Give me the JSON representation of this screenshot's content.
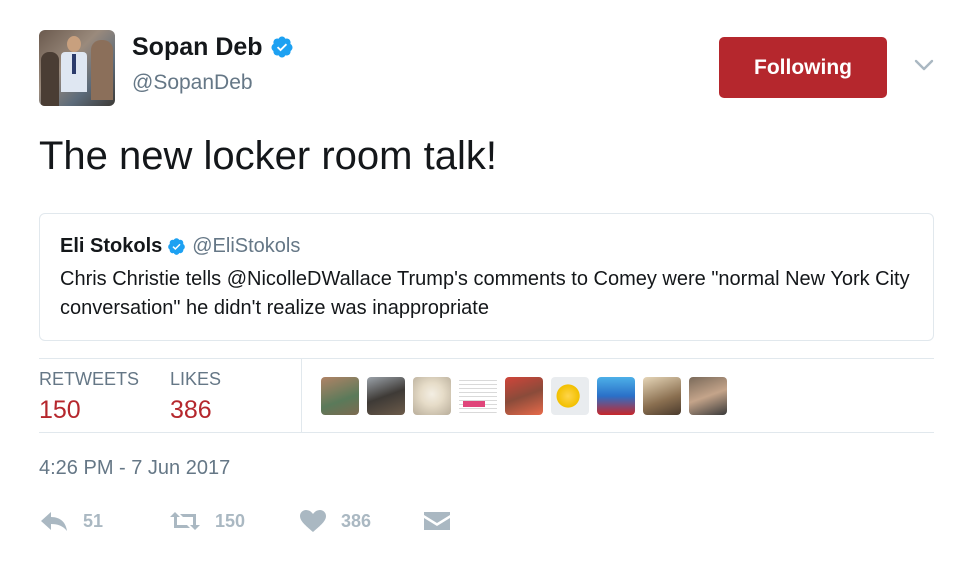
{
  "author": {
    "name": "Sopan Deb",
    "handle": "@SopanDeb",
    "verified": true
  },
  "follow_button": {
    "label": "Following",
    "color": "#b5272d"
  },
  "tweet": {
    "text": "The new locker room talk!"
  },
  "quoted_tweet": {
    "name": "Eli Stokols",
    "handle": "@EliStokols",
    "verified": true,
    "text": "Chris Christie tells @NicolleDWallace Trump's comments to Comey were \"normal New York City conversation\" he didn't realize was inappropriate"
  },
  "stats": {
    "retweets_label": "RETWEETS",
    "retweets_value": "150",
    "likes_label": "LIKES",
    "likes_value": "386"
  },
  "likers": [
    {
      "icon": "liker-avatar"
    },
    {
      "icon": "liker-avatar"
    },
    {
      "icon": "liker-avatar"
    },
    {
      "icon": "liker-avatar"
    },
    {
      "icon": "liker-avatar"
    },
    {
      "icon": "liker-avatar"
    },
    {
      "icon": "liker-avatar"
    },
    {
      "icon": "liker-avatar"
    },
    {
      "icon": "liker-avatar"
    }
  ],
  "timestamp": "4:26 PM - 7 Jun 2017",
  "actions": {
    "reply_count": "51",
    "retweet_count": "150",
    "like_count": "386"
  },
  "colors": {
    "accent": "#b5272d",
    "verified": "#1da1f2",
    "secondary_text": "#657786",
    "action_gray": "#aab8c2"
  }
}
